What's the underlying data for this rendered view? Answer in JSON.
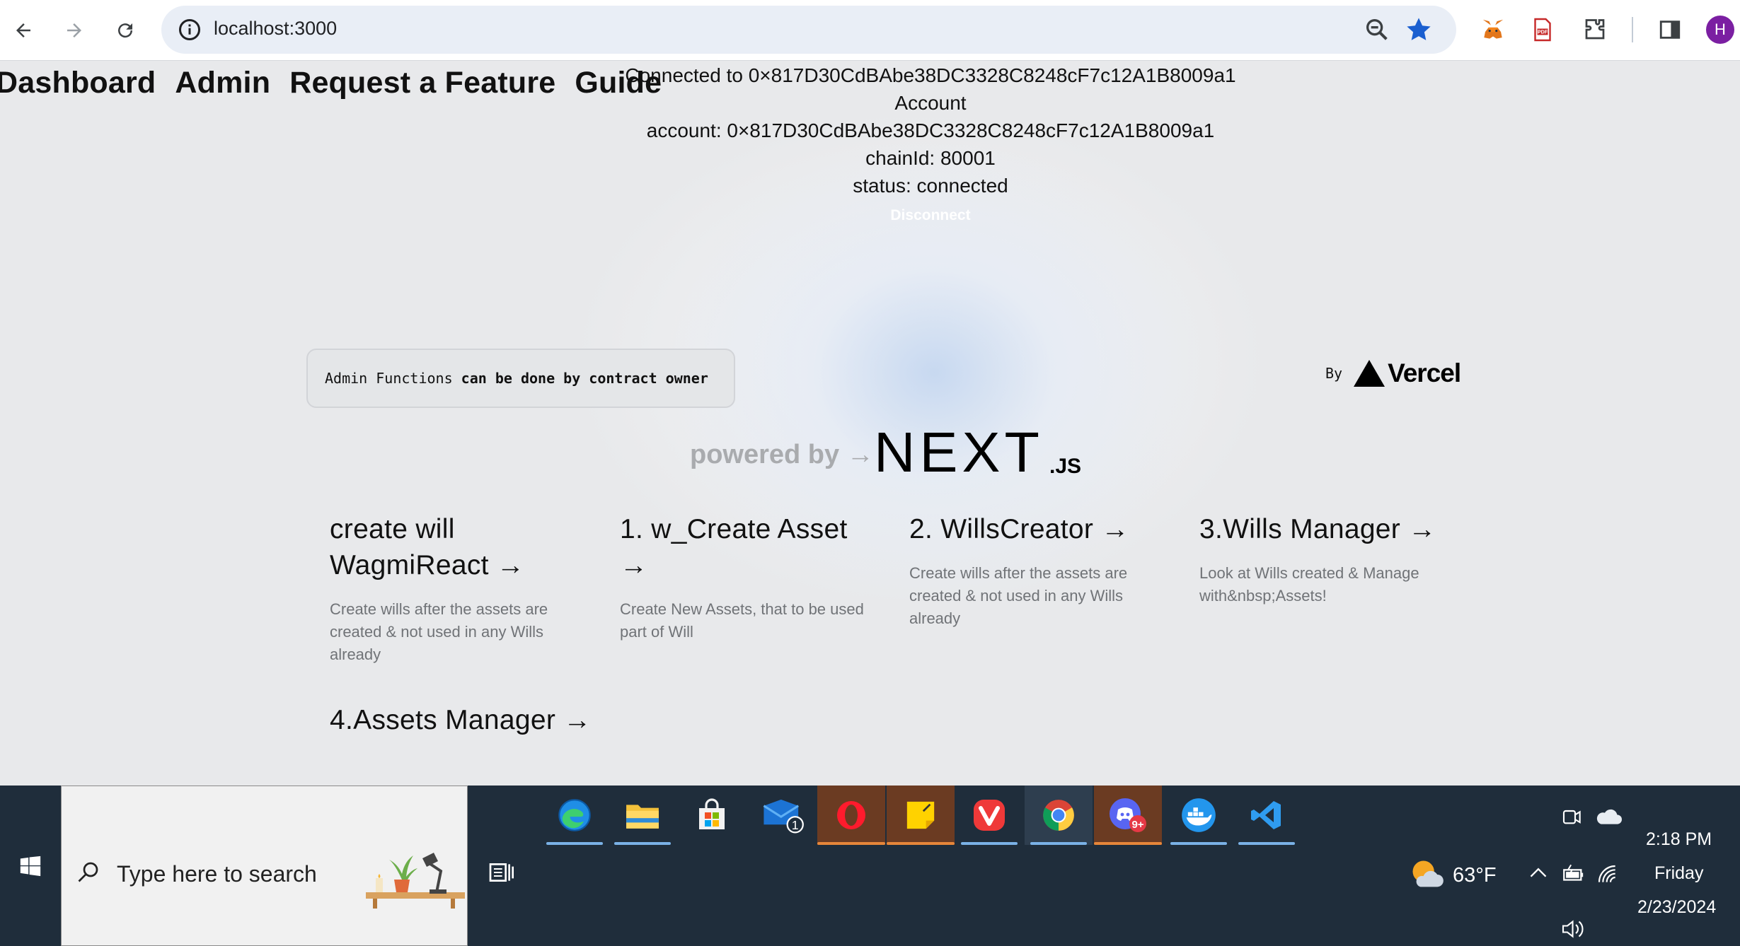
{
  "browser": {
    "url": "localhost:3000",
    "profile_initial": "H"
  },
  "nav": {
    "items": [
      "Dashboard",
      "Admin",
      "Request a Feature",
      "Guide"
    ]
  },
  "account": {
    "connected_line": "Connected to 0×817D30CdBAbe38DC3328C8248cF7c12A1B8009a1",
    "heading": "Account",
    "account_line": "account: 0×817D30CdBAbe38DC3328C8248cF7c12A1B8009a1",
    "chain_line": "chainId: 80001",
    "status_line": "status: connected",
    "disconnect_label": "Disconnect"
  },
  "admin_note": {
    "part1": "Admin Functions",
    "part2": " can be done by contract owner"
  },
  "vercel": {
    "by_label": "By",
    "brand": "Vercel"
  },
  "powered": {
    "text": "powered by →",
    "logo_main": "NEXT",
    "logo_suffix": ".JS"
  },
  "cards": [
    {
      "title": "create will WagmiReact →",
      "desc": "Create wills after the assets are created & not used in any Wills already"
    },
    {
      "title": "1. w_Create Asset →",
      "desc": "Create New Assets, that to be used part of Will"
    },
    {
      "title": "2. WillsCreator →",
      "desc": "Create wills after the assets are created & not used in any Wills already"
    },
    {
      "title": "3.Wills Manager →",
      "desc": "Look at Wills created & Manage with&nbsp;Assets!"
    },
    {
      "title": "4.Assets Manager →",
      "desc": ""
    }
  ],
  "taskbar": {
    "search_placeholder": "Type here to search",
    "mail_badge": "1",
    "discord_badge": "9+",
    "weather": "63°F",
    "time": "2:18 PM",
    "day": "Friday",
    "date": "2/23/2024"
  }
}
